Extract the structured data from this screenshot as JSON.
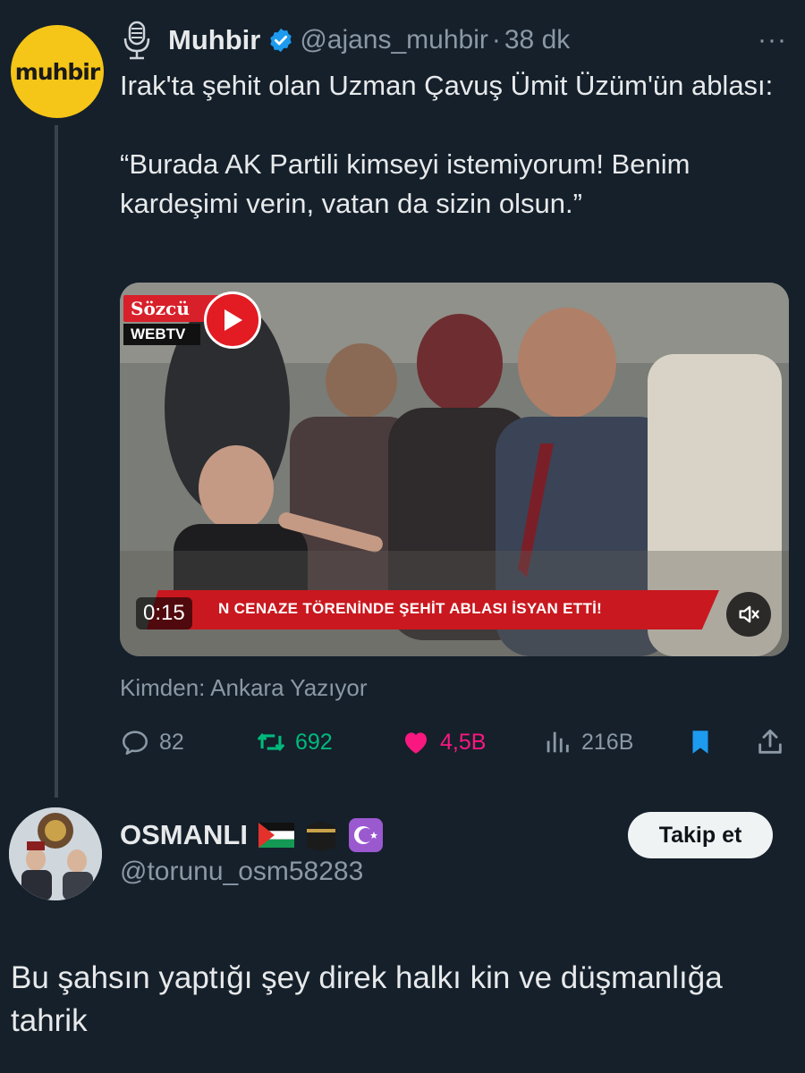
{
  "tweet": {
    "author_avatar_text": "muhbir",
    "author_name": "Muhbir",
    "handle": "@ajans_muhbir",
    "separator": "·",
    "time": "38 dk",
    "more": "···",
    "text_line1": "Irak'ta şehit olan Uzman Çavuş Ümit Üzüm'ün ablası:",
    "text_line2": "“Burada AK Partili kimseyi istemiyorum! Benim kardeşimi verin, vatan da sizin olsun.”",
    "video": {
      "logo_top": "Sözcü",
      "logo_bottom": "WEBTV",
      "banner_text": "N CENAZE TÖRENİNDE ŞEHİT ABLASI İSYAN ETTİ!",
      "duration": "0:15"
    },
    "source": "Kimden: Ankara Yazıyor",
    "stats": {
      "replies": "82",
      "retweets": "692",
      "likes": "4,5B",
      "views": "216B"
    }
  },
  "reply": {
    "name": "OSMANLI",
    "handle": "@torunu_osm58283",
    "follow_label": "Takip et",
    "text": "Bu şahsın yaptığı şey direk halkı kin ve düşmanlığa tahrik"
  },
  "colors": {
    "background": "#15202b",
    "text": "#e7e9ea",
    "muted": "#8b98a5",
    "verified": "#1d9bf0",
    "retweet": "#00ba7c",
    "like": "#f91880",
    "avatar_yellow": "#f5c518"
  }
}
